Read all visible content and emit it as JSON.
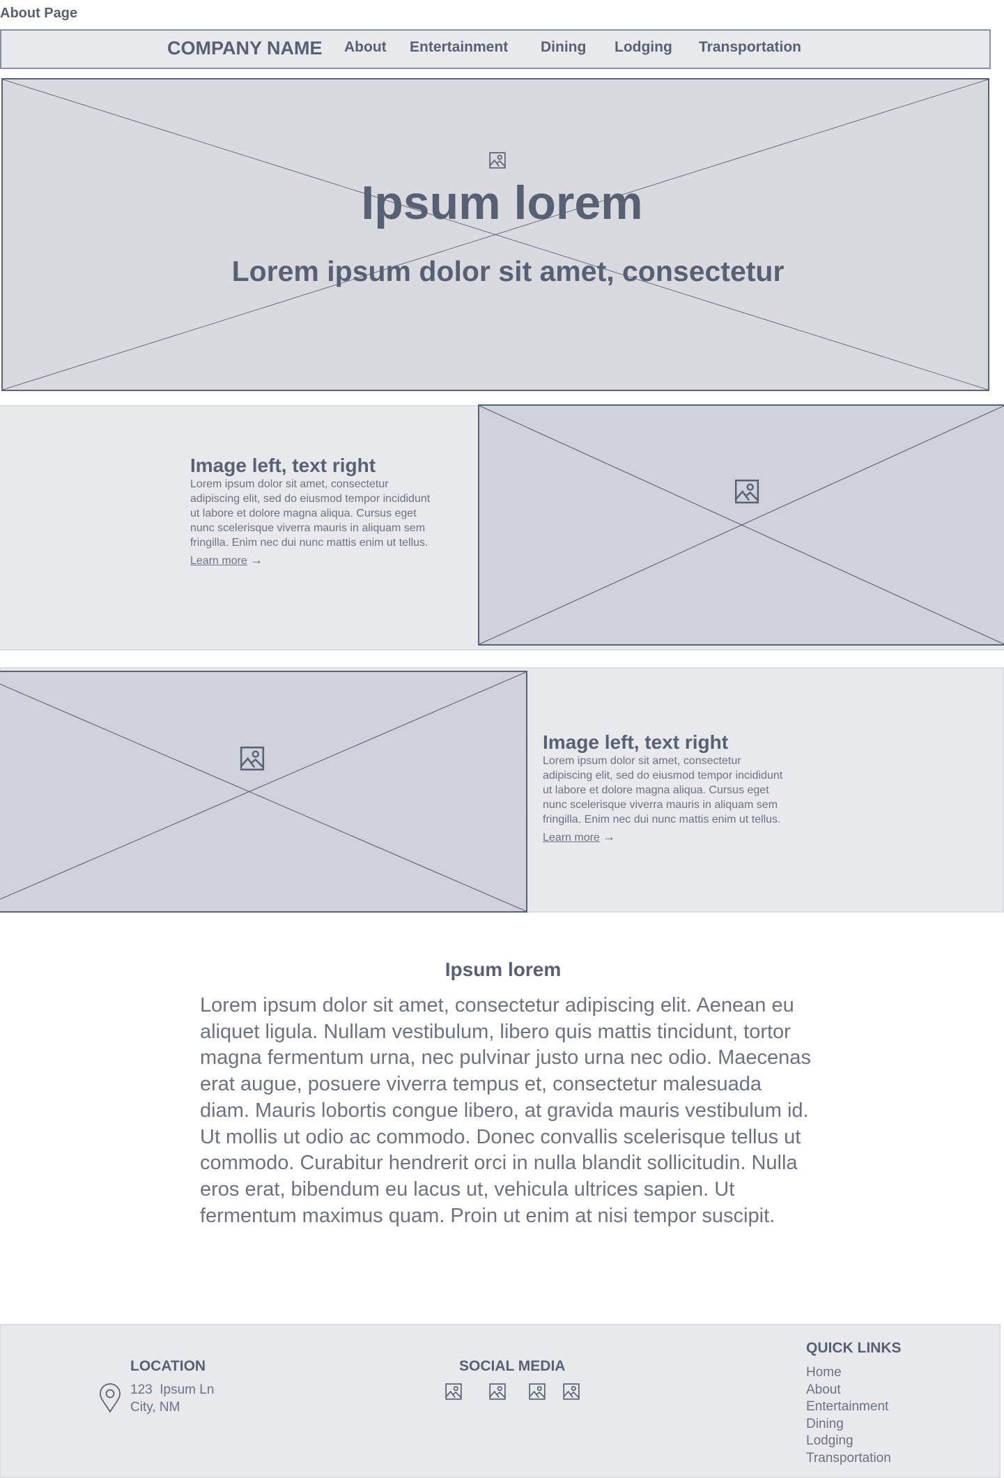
{
  "page_label": "About Page",
  "nav": {
    "company": "COMPANY NAME",
    "items": [
      "About",
      "Entertainment",
      "Dining",
      "Lodging",
      "Transportation"
    ]
  },
  "hero": {
    "title": "Ipsum lorem",
    "subtitle": "Lorem ipsum dolor sit amet, consectetur",
    "icon": "image-icon"
  },
  "feature1": {
    "heading": "Image left, text right",
    "body": "Lorem ipsum dolor sit amet, consectetur adipiscing elit, sed do eiusmod tempor incididunt ut labore et dolore magna aliqua. Cursus eget nunc scelerisque viverra mauris in aliquam sem fringilla. Enim nec dui nunc mattis enim ut tellus.",
    "link": "Learn more"
  },
  "feature2": {
    "heading": "Image left, text right",
    "body": "Lorem ipsum dolor sit amet, consectetur adipiscing elit, sed do eiusmod tempor incididunt ut labore et dolore magna aliqua. Cursus eget nunc scelerisque viverra mauris in aliquam sem fringilla. Enim nec dui nunc mattis enim ut tellus.",
    "link": "Learn more"
  },
  "content": {
    "heading": "Ipsum lorem",
    "body": "Lorem ipsum dolor sit amet, consectetur adipiscing elit. Aenean eu aliquet ligula. Nullam vestibulum, libero quis mattis tincidunt, tortor magna fermentum urna, nec pulvinar justo urna nec odio. Maecenas erat augue, posuere viverra tempus et, consectetur malesuada diam. Mauris lobortis congue libero, at gravida mauris vestibulum id. Ut mollis ut odio ac commodo. Donec convallis scelerisque tellus ut commodo. Curabitur hendrerit orci in nulla blandit sollicitudin. Nulla eros erat, bibendum eu lacus ut, vehicula ultrices sapien. Ut fermentum maximus quam. Proin ut enim at nisi tempor suscipit."
  },
  "footer": {
    "location": {
      "heading": "LOCATION",
      "line1": "123  Ipsum Ln",
      "line2": "City, NM"
    },
    "social": {
      "heading": "SOCIAL MEDIA",
      "icons": [
        "image-icon",
        "image-icon",
        "image-icon",
        "image-icon"
      ]
    },
    "quick_links": {
      "heading": "QUICK LINKS",
      "items": [
        "Home",
        "About",
        "Entertainment",
        "Dining",
        "Lodging",
        "Transportation"
      ]
    }
  },
  "colors": {
    "text": "#586073",
    "panel": "#e8e9ed",
    "placeholder": "#d9dadf",
    "placeholder_dark": "#cfd2da",
    "stroke": "#5a6275"
  }
}
